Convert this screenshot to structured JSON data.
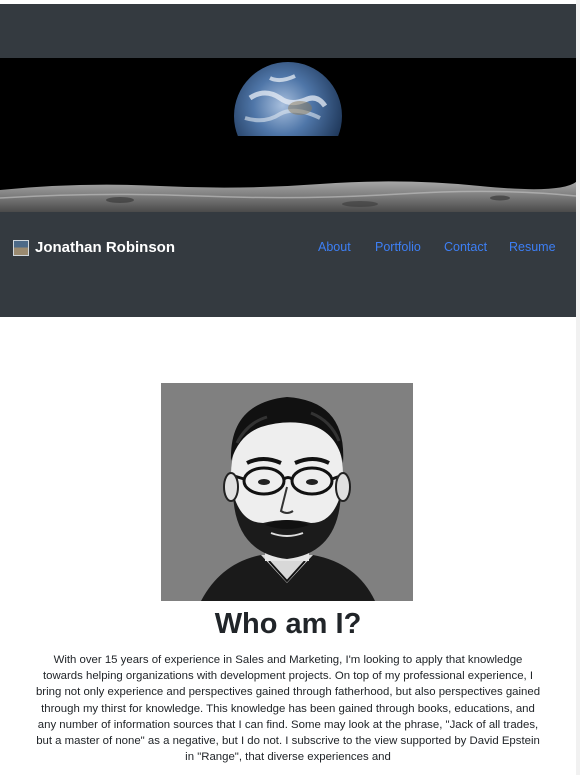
{
  "brand": {
    "name": "Jonathan Robinson",
    "icon": "profile-thumbnail-icon"
  },
  "nav": {
    "items": [
      {
        "label": "About"
      },
      {
        "label": "Portfolio"
      },
      {
        "label": "Contact"
      },
      {
        "label": "Resume"
      }
    ]
  },
  "banner": {
    "image": "earthrise-over-moon"
  },
  "portrait": {
    "image": "black-and-white-portrait"
  },
  "about": {
    "title": "Who am I?",
    "body": "With over 15 years of experience in Sales and Marketing, I'm looking to apply that knowledge towards helping organizations with development projects. On top of my professional experience, I bring not only experience and perspectives gained through fatherhood, but also perspectives gained through my thirst for knowledge. This knowledge has been gained through books, educations, and any number of information sources that I can find. Some may look at the phrase, \"Jack of all trades, but a master of none\" as a negative, but I do not. I subscrive to the view supported by David Epstein in \"Range\", that diverse experiences and"
  },
  "colors": {
    "header_bg": "#343a40",
    "link": "#3d7ff5",
    "text": "#212529",
    "portrait_bg": "#808080"
  }
}
